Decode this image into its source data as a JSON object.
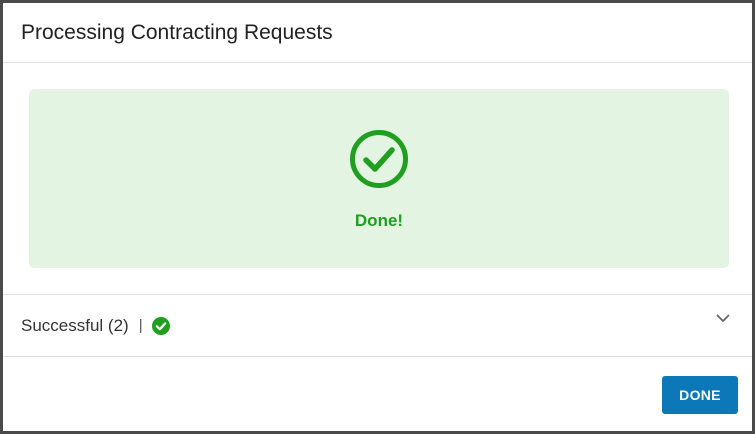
{
  "dialog": {
    "title": "Processing Contracting Requests"
  },
  "status": {
    "icon": "check-circle-icon",
    "message": "Done!",
    "color": "#1f9e1f",
    "panel_color": "#e3f4e3"
  },
  "results": {
    "label": "Successful (2)",
    "separator": "|",
    "status_icon": "check-circle-filled-icon",
    "toggle_icon": "chevron-down-icon"
  },
  "footer": {
    "done_label": "DONE",
    "button_color": "#0d78b8"
  }
}
